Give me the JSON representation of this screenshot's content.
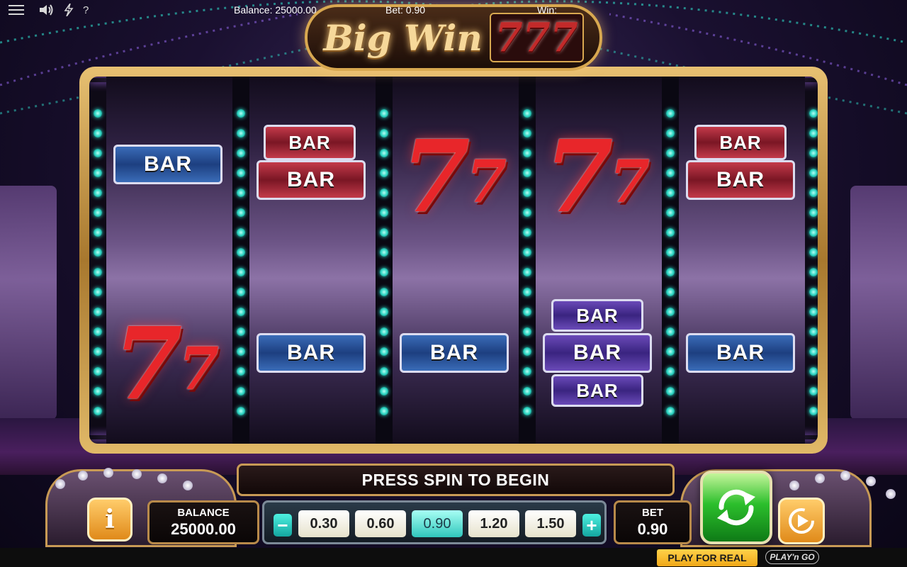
{
  "game": {
    "logo_text": "Big Win",
    "logo_sevens": "777"
  },
  "reels": [
    {
      "id": "reel-1",
      "symbols": [
        {
          "kind": "bar",
          "text": "BAR",
          "color": "blue"
        },
        {
          "kind": "seven",
          "text": "7"
        }
      ]
    },
    {
      "id": "reel-2",
      "symbols": [
        {
          "kind": "bar",
          "text": "BAR",
          "color": "red",
          "stack": "double-top"
        },
        {
          "kind": "bar",
          "text": "BAR",
          "color": "red",
          "stack": "double-bottom"
        },
        {
          "kind": "bar",
          "text": "BAR",
          "color": "blue"
        }
      ]
    },
    {
      "id": "reel-3",
      "symbols": [
        {
          "kind": "seven",
          "text": "7"
        },
        {
          "kind": "bar",
          "text": "BAR",
          "color": "blue"
        }
      ]
    },
    {
      "id": "reel-4",
      "symbols": [
        {
          "kind": "seven",
          "text": "7"
        },
        {
          "kind": "bar",
          "text": "BAR",
          "color": "purple",
          "stack": "triple-top"
        },
        {
          "kind": "bar",
          "text": "BAR",
          "color": "purple",
          "stack": "triple-middle"
        },
        {
          "kind": "bar",
          "text": "BAR",
          "color": "purple",
          "stack": "triple-bottom"
        }
      ]
    },
    {
      "id": "reel-5",
      "symbols": [
        {
          "kind": "bar",
          "text": "BAR",
          "color": "red",
          "stack": "double-top"
        },
        {
          "kind": "bar",
          "text": "BAR",
          "color": "red",
          "stack": "double-bottom"
        },
        {
          "kind": "bar",
          "text": "BAR",
          "color": "blue"
        }
      ]
    }
  ],
  "controls": {
    "message": "PRESS SPIN TO BEGIN",
    "balance_label": "BALANCE",
    "balance_value": "25000.00",
    "bet_label": "BET",
    "bet_value": "0.90",
    "info_label": "i",
    "decrease_label": "−",
    "increase_label": "+",
    "bet_options": [
      "0.30",
      "0.60",
      "0.90",
      "1.20",
      "1.50"
    ],
    "selected_bet": "0.90"
  },
  "footer": {
    "balance": "Balance: 25000.00",
    "bet": "Bet: 0.90",
    "win": "Win:",
    "play_for_real": "PLAY FOR REAL",
    "brand": "PLAY'n GO",
    "help": "?"
  },
  "colors": {
    "gold_frame": "#d8a850",
    "reel_light": "#2cd6c4",
    "spin_green": "#2cbf2c",
    "play_for_real": "#f0a818",
    "bar_blue": "#1d3f80",
    "bar_red": "#7a1624",
    "bar_purple": "#3a2480",
    "seven_red": "#e8262a"
  }
}
